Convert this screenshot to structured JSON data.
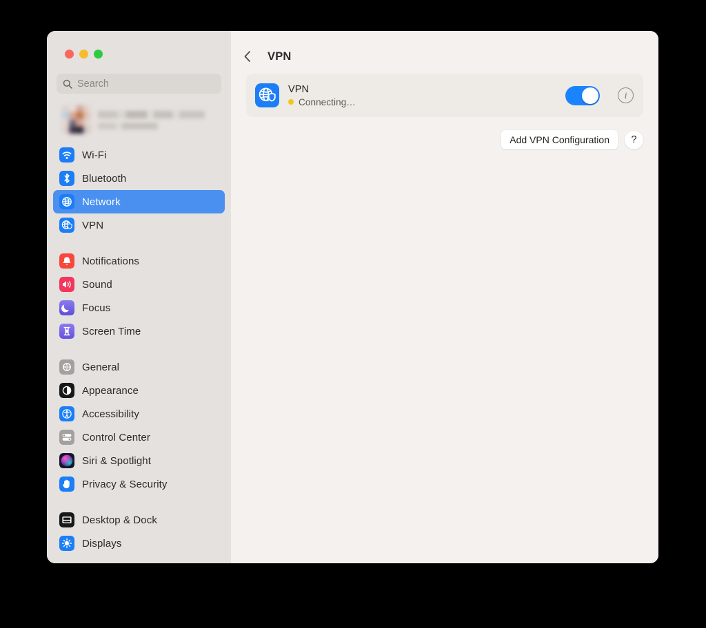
{
  "window": {
    "traffic_lights": [
      "close",
      "minimize",
      "zoom"
    ],
    "colors": {
      "sidebar_bg": "#e5e1de",
      "content_bg": "#f4f1ee",
      "selection_blue": "#4a90f0",
      "toggle_on_blue": "#1a84ff",
      "status_dot_yellow": "#f5c518",
      "cursor_red": "#f81c14",
      "desktop_bg": "#000000"
    }
  },
  "sidebar": {
    "search": {
      "placeholder": "Search",
      "value": "",
      "icon": "search-icon"
    },
    "account": {
      "name_redacted": true,
      "subtitle_redacted": true,
      "avatar_redacted": true
    },
    "groups": [
      {
        "items": [
          {
            "label": "Wi-Fi",
            "icon": "wifi-icon",
            "selected": false
          },
          {
            "label": "Bluetooth",
            "icon": "bluetooth-icon",
            "selected": false
          },
          {
            "label": "Network",
            "icon": "network-globe-icon",
            "selected": true
          },
          {
            "label": "VPN",
            "icon": "vpn-globe-shield-icon",
            "selected": false
          }
        ]
      },
      {
        "items": [
          {
            "label": "Notifications",
            "icon": "notifications-bell-icon",
            "selected": false
          },
          {
            "label": "Sound",
            "icon": "sound-speaker-icon",
            "selected": false
          },
          {
            "label": "Focus",
            "icon": "focus-moon-icon",
            "selected": false
          },
          {
            "label": "Screen Time",
            "icon": "screen-time-hourglass-icon",
            "selected": false
          }
        ]
      },
      {
        "items": [
          {
            "label": "General",
            "icon": "general-gear-icon",
            "selected": false
          },
          {
            "label": "Appearance",
            "icon": "appearance-contrast-icon",
            "selected": false
          },
          {
            "label": "Accessibility",
            "icon": "accessibility-person-icon",
            "selected": false
          },
          {
            "label": "Control Center",
            "icon": "control-center-switches-icon",
            "selected": false
          },
          {
            "label": "Siri & Spotlight",
            "icon": "siri-orb-icon",
            "selected": false
          },
          {
            "label": "Privacy & Security",
            "icon": "privacy-hand-icon",
            "selected": false
          }
        ]
      },
      {
        "items": [
          {
            "label": "Desktop & Dock",
            "icon": "desktop-dock-icon",
            "selected": false
          },
          {
            "label": "Displays",
            "icon": "displays-brightness-icon",
            "selected": false
          }
        ]
      }
    ]
  },
  "main": {
    "back_button": "back-chevron-icon",
    "title": "VPN",
    "vpn_row": {
      "icon": "vpn-globe-shield-icon",
      "name": "VPN",
      "status": "Connecting…",
      "status_dot_color": "#f5c518",
      "toggle_state": "on",
      "info_button": "i"
    },
    "actions": {
      "add_label": "Add VPN Configuration",
      "help_label": "?"
    }
  },
  "overlay": {
    "cursor": "pointing-hand-cursor-icon",
    "cursor_color": "#f81c14"
  }
}
